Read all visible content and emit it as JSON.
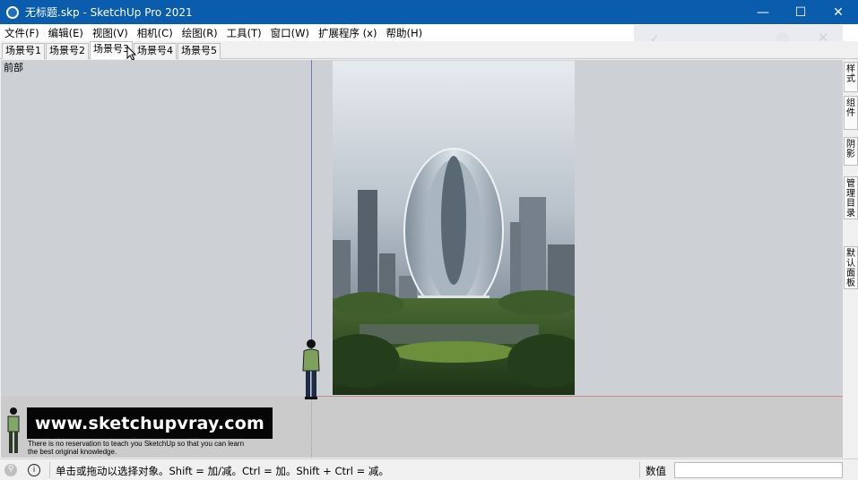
{
  "window": {
    "title": "无标题.skp - SketchUp Pro 2021",
    "minimize_glyph": "—",
    "maximize_glyph": "☐",
    "close_glyph": "✕"
  },
  "menu": [
    "文件(F)",
    "编辑(E)",
    "视图(V)",
    "相机(C)",
    "绘图(R)",
    "工具(T)",
    "窗口(W)",
    "扩展程序 (x)",
    "帮助(H)"
  ],
  "scenes": {
    "tabs": [
      "场景号1",
      "场景号2",
      "场景号3",
      "场景号4",
      "场景号5"
    ],
    "active_index": 2
  },
  "viewport": {
    "view_label": "前部"
  },
  "watermark": {
    "url": "www.sketchupvray.com",
    "line1": "There is no reservation to teach you SketchUp so that you can learn",
    "line2": " the best original knowledge."
  },
  "right_panel": {
    "tabs": [
      "样式",
      "组件",
      "阴影",
      "管理目录",
      "默认面板"
    ]
  },
  "status": {
    "hint": "单击或拖动以选择对象。Shift = 加/减。Ctrl = 加。Shift + Ctrl = 减。",
    "measurement_label": "数值",
    "measurement_value": ""
  },
  "colors": {
    "titlebar": "#0a5cad",
    "viewport_sky": "#cdd1d5",
    "ground": "#cbcbcb",
    "blue_axis": "#6c7ab8",
    "red_axis": "#c98a8a"
  }
}
